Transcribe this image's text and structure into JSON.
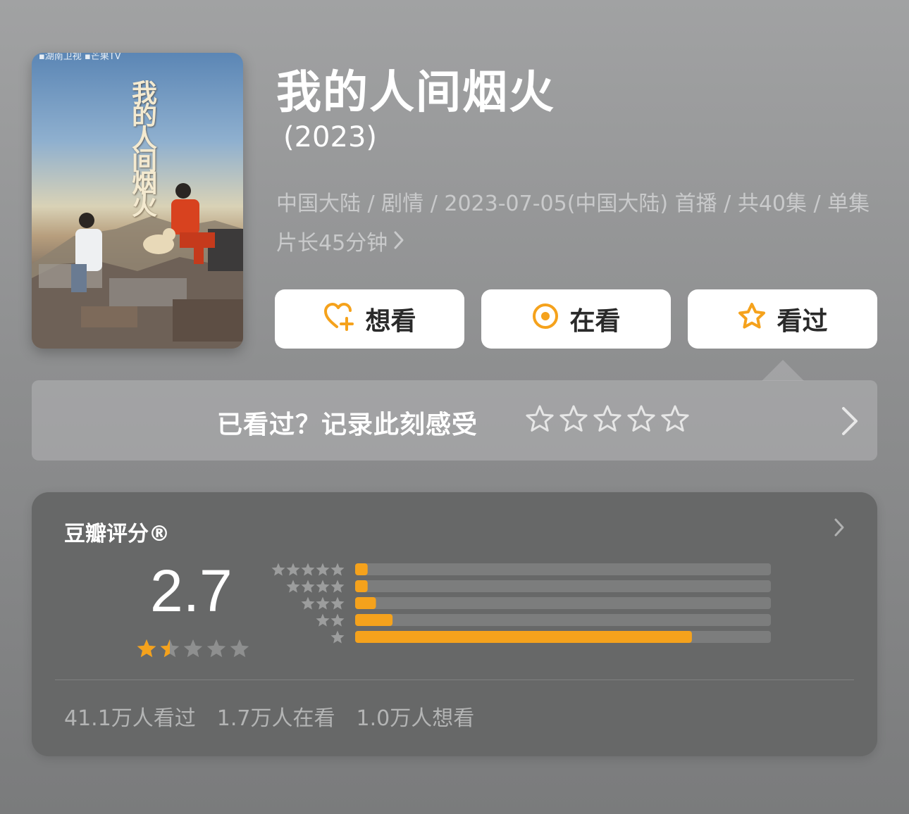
{
  "poster": {
    "title": "我的人间烟火",
    "logos": "▪湖南卫视 ▪芒果TV"
  },
  "header": {
    "title": "我的人间烟火",
    "year": "(2023)",
    "meta": "中国大陆 / 剧情 / 2023-07-05(中国大陆) 首播 / 共40集 / 单集片长45分钟"
  },
  "actions": {
    "want": {
      "label": "想看",
      "icon": "heart-plus-icon"
    },
    "doing": {
      "label": "在看",
      "icon": "target-icon"
    },
    "done": {
      "label": "看过",
      "icon": "star-icon"
    }
  },
  "prompt": {
    "text": "已看过？记录此刻感受",
    "stars": 5
  },
  "rating": {
    "label": "豆瓣评分®",
    "score": "2.7",
    "score_stars": 1.5,
    "distribution": [
      {
        "stars": 5,
        "percent": 3
      },
      {
        "stars": 4,
        "percent": 3
      },
      {
        "stars": 3,
        "percent": 5
      },
      {
        "stars": 2,
        "percent": 9
      },
      {
        "stars": 1,
        "percent": 81
      }
    ],
    "counts": {
      "watched": "41.1万人看过",
      "watching": "1.7万人在看",
      "want": "1.0万人想看"
    }
  },
  "colors": {
    "accent": "#f5a21c",
    "card": "#676868",
    "track": "#7c7d7d"
  }
}
